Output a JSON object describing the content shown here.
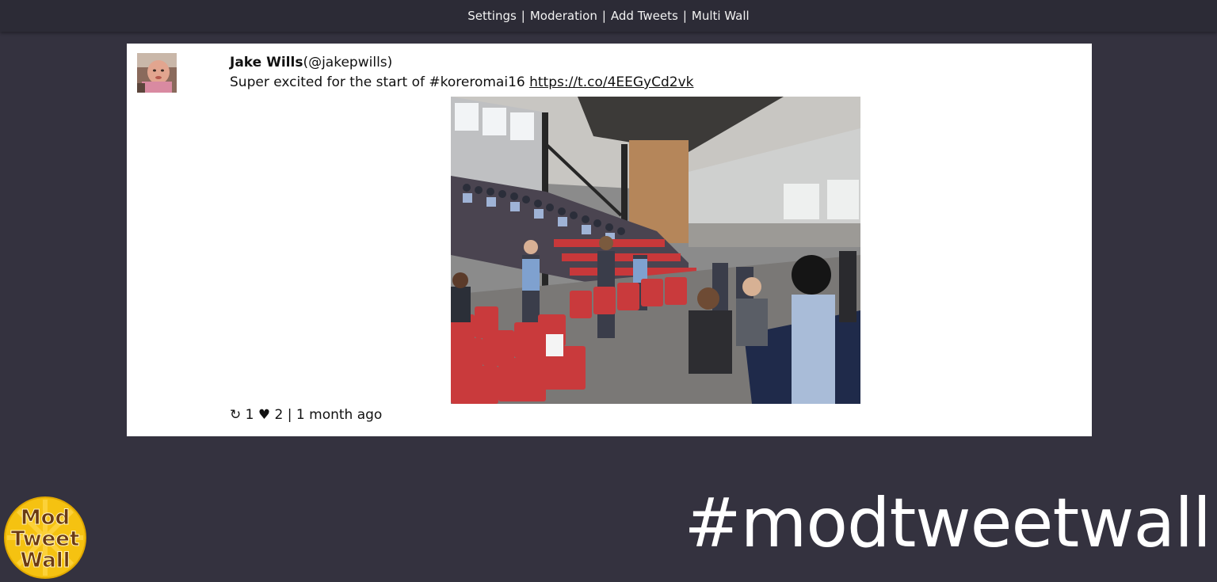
{
  "nav": {
    "items": [
      "Settings",
      "Moderation",
      "Add Tweets",
      "Multi Wall"
    ],
    "separator": "|"
  },
  "tweet": {
    "author_name": "Jake Wills",
    "handle": "(@jakepwills)",
    "text": "Super excited for the start of #koreromai16 ",
    "link": "https://t.co/4EEGyCd2vk",
    "retweet_icon": "↻",
    "retweet_count": "1",
    "like_icon": "♥",
    "like_count": "2",
    "meta_separator": "|",
    "time_ago": "1 month ago"
  },
  "branding": {
    "logo_text": [
      "Mod",
      "Tweet",
      "Wall"
    ],
    "hashtag": "#modtweetwall"
  },
  "colors": {
    "background": "#34323f",
    "topbar": "#2c2b36",
    "card": "#ffffff",
    "logo_fill": "#f5c211",
    "logo_text": "#6b3a12"
  }
}
